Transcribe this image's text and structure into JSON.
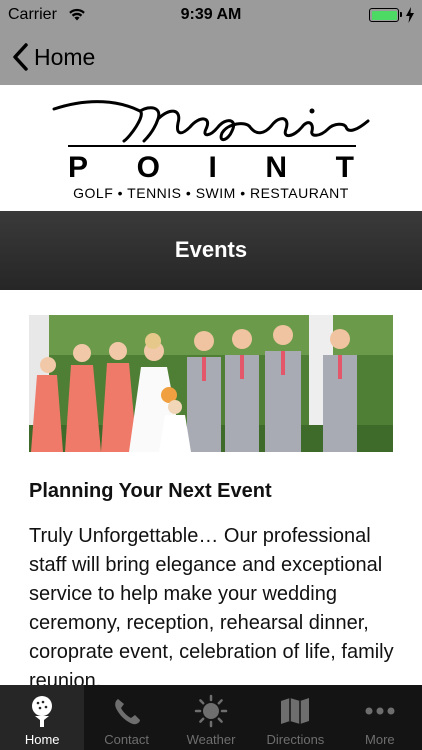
{
  "status_bar": {
    "carrier": "Carrier",
    "time": "9:39 AM"
  },
  "nav": {
    "back_label": "Home"
  },
  "logo": {
    "script_text": "Magnolia",
    "point_letters": [
      "P",
      "O",
      "I",
      "N",
      "T"
    ],
    "tagline": "GOLF • TENNIS • SWIM • RESTAURANT"
  },
  "header": {
    "title": "Events"
  },
  "content": {
    "heading": "Planning Your Next Event",
    "body": "Truly Unforgettable… Our professional staff will bring elegance and exceptional service to help make your wedding ceremony, reception, rehearsal dinner, coroprate event, celebration of life, family reunion,"
  },
  "tabs": [
    {
      "label": "Home",
      "icon": "golf-ball-tee-icon",
      "active": true
    },
    {
      "label": "Contact",
      "icon": "phone-icon",
      "active": false
    },
    {
      "label": "Weather",
      "icon": "sun-icon",
      "active": false
    },
    {
      "label": "Directions",
      "icon": "map-icon",
      "active": false
    },
    {
      "label": "More",
      "icon": "more-dots-icon",
      "active": false
    }
  ],
  "colors": {
    "nav_bg": "#9b9b9b",
    "header_bg": "#2f2f2f",
    "tab_bar_bg": "#141414",
    "battery": "#4cd964"
  }
}
